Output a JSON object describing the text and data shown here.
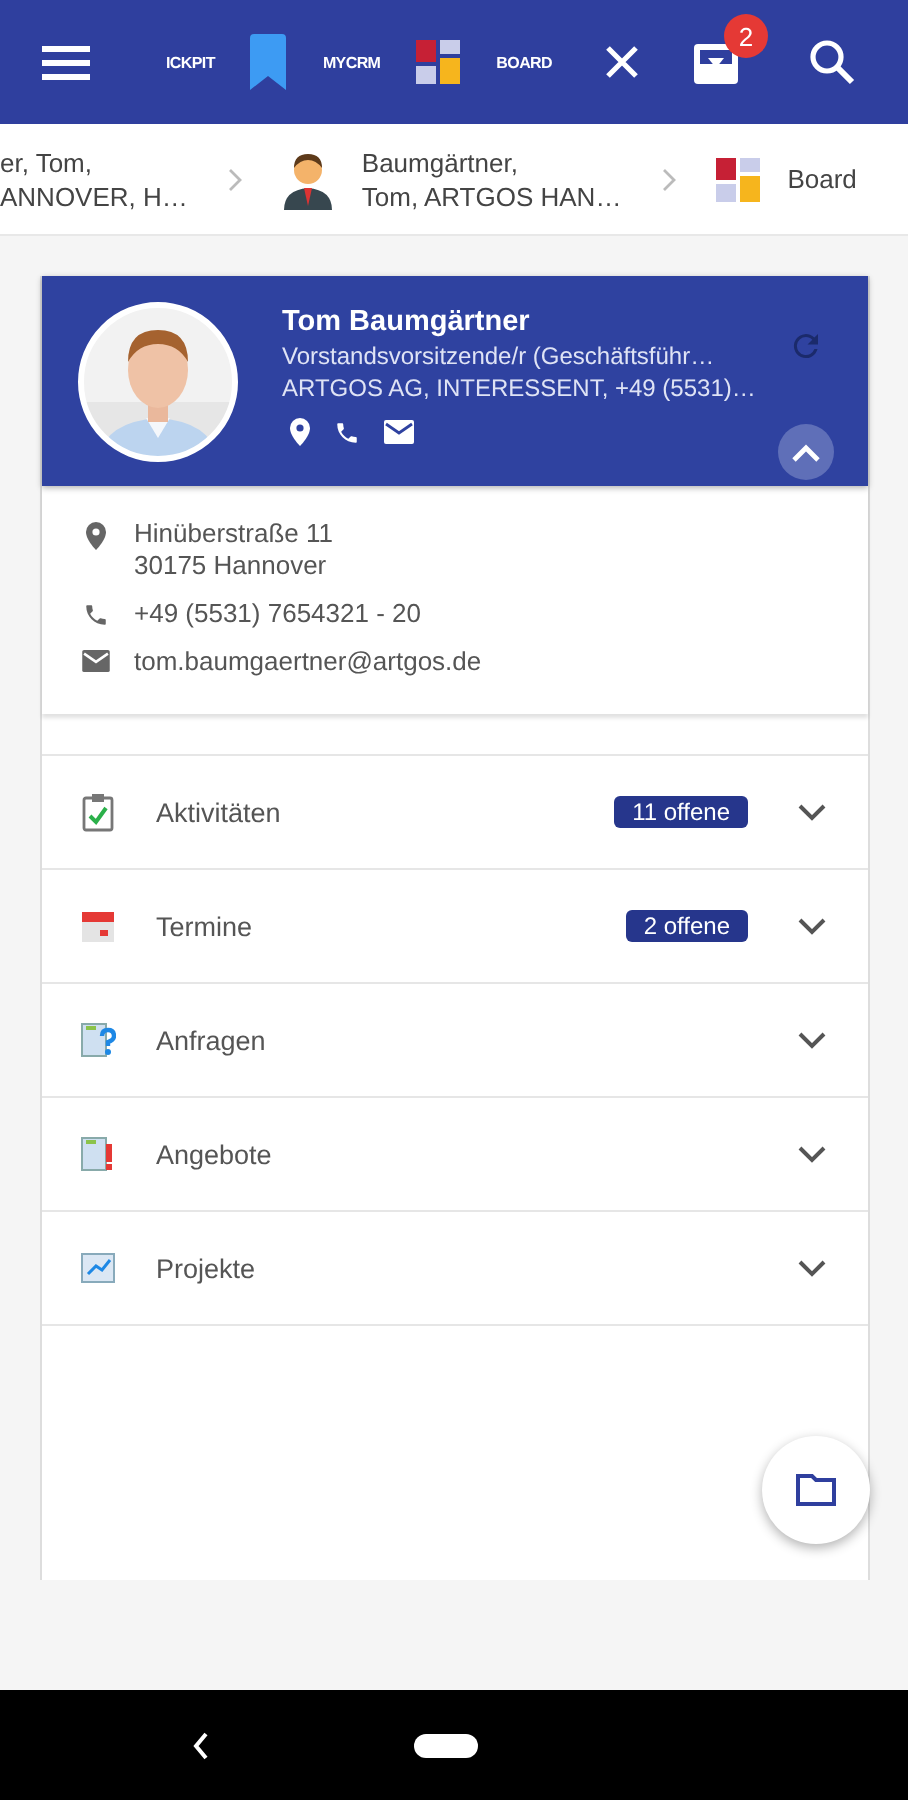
{
  "top_bar": {
    "tabs": [
      {
        "kind": "text",
        "label": "ICKPIT"
      },
      {
        "kind": "bookmark",
        "label": "MYCRM"
      },
      {
        "kind": "board",
        "label": "BOARD"
      }
    ],
    "notification_count": "2"
  },
  "breadcrumbs": [
    {
      "kind": "text",
      "label": "er, Tom,\nANNOVER, H…"
    },
    {
      "kind": "person",
      "label": "Baumgärtner,\nTom, ARTGOS HAN…"
    },
    {
      "kind": "board",
      "label": "Board"
    }
  ],
  "contact": {
    "name": "Tom Baumgärtner",
    "title": "Vorstandsvorsitzende/r (Geschäftsführ…",
    "company": "ARTGOS AG, INTERESSENT, +49 (5531)…",
    "expanded": true,
    "details": [
      {
        "kind": "address",
        "lines": "Hinüberstraße 11\n30175 Hannover"
      },
      {
        "kind": "phone",
        "lines": "+49 (5531) 7654321 - 20"
      },
      {
        "kind": "email",
        "lines": "tom.baumgaertner@artgos.de"
      }
    ]
  },
  "sections": [
    {
      "kind": "activities",
      "label": "Aktivitäten",
      "badge": "11 offene",
      "expanded": false
    },
    {
      "kind": "appointments",
      "label": "Termine",
      "badge": "2 offene",
      "expanded": false
    },
    {
      "kind": "inquiries",
      "label": "Anfragen",
      "expanded": false
    },
    {
      "kind": "offers",
      "label": "Angebote",
      "expanded": false
    },
    {
      "kind": "projects",
      "label": "Projekte",
      "expanded": false
    }
  ]
}
